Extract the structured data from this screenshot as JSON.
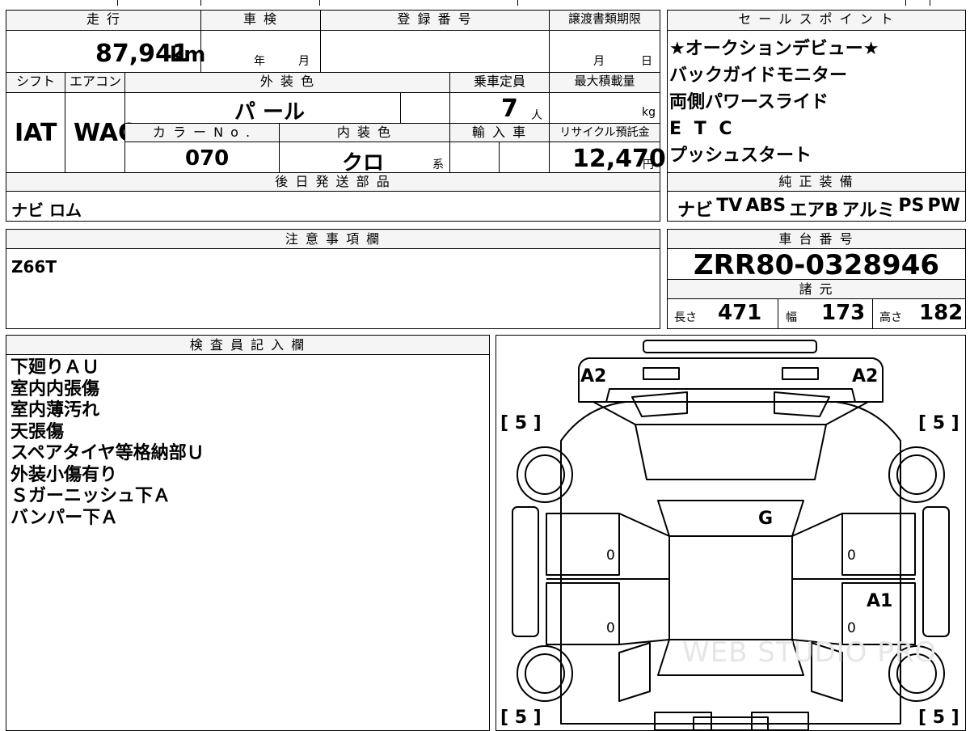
{
  "top": {
    "mileage_label": "走 行",
    "mileage_value": "87,941",
    "mileage_unit": "km",
    "shaken_label": "車 検",
    "shaken_year": "年",
    "shaken_month": "月",
    "regno_label": "登 録 番 号",
    "transfer_label": "譲渡書類期限",
    "transfer_month": "月",
    "transfer_day": "日",
    "shift_label": "シフト",
    "shift_value": "IAT",
    "ac_label": "エアコン",
    "ac_value": "WAC",
    "ext_color_label": "外 装 色",
    "ext_color_value": "パ ール",
    "capacity_label": "乗車定員",
    "capacity_value": "7",
    "capacity_unit": "人",
    "maxload_label": "最大積載量",
    "maxload_unit": "kg",
    "color_no_label": "カ ラ ー N o .",
    "color_no_value": "070",
    "int_color_label": "内 装 色",
    "int_color_value": "クロ",
    "int_color_suffix": "系",
    "import_label": "輸 入 車",
    "recycle_label": "リサイクル預託金",
    "recycle_value": "12,470",
    "recycle_unit": "円",
    "later_parts_label": "後 日 発 送 部 品",
    "later_parts_value": "ナビ ロム"
  },
  "sales": {
    "label": "セ ー ル ス ポ イ ン ト",
    "lines": [
      "★オークションデビュー★",
      "バックガイドモニター",
      "両側パワースライド",
      "E T C",
      "プッシュスタート"
    ]
  },
  "equipment": {
    "label": "純 正 装 備",
    "items": [
      "ナビ",
      "TV",
      "ABS",
      "エアB",
      "アルミ",
      "PS",
      "PW"
    ]
  },
  "caution": {
    "label": "注 意 事 項 欄",
    "value": "Z66T"
  },
  "chassis": {
    "label": "車 台 番 号",
    "value": "ZRR80-0328946",
    "dims_label": "諸 元",
    "length_label": "長さ",
    "length_value": "471",
    "width_label": "幅",
    "width_value": "173",
    "height_label": "高さ",
    "height_value": "182"
  },
  "inspector": {
    "label": "検 査 員 記 入 欄",
    "lines": [
      "下廻りＡＵ",
      "室内内張傷",
      "室内薄汚れ",
      "天張傷",
      "スペアタイヤ等格納部Ｕ",
      "外装小傷有り",
      "Ｓガーニッシュ下Ａ",
      "バンパー下Ａ"
    ]
  },
  "diagram": {
    "marks": [
      "A2",
      "A2",
      "G",
      "A1"
    ],
    "tire_labels": [
      "[ 5 ]",
      "[ 5 ]",
      "[ 5 ]",
      "[ 5 ]"
    ],
    "door_zeros": [
      "0",
      "0",
      "0",
      "0"
    ],
    "watermark": "WEB STUDIO PRO"
  }
}
